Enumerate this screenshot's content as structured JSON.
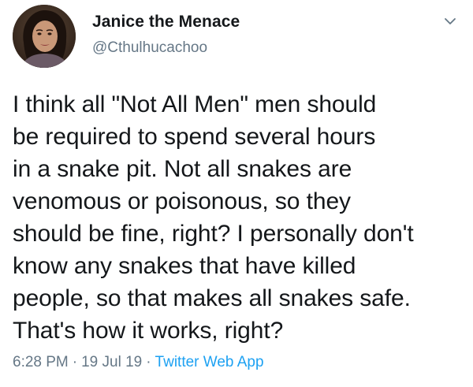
{
  "tweet": {
    "author": {
      "display_name": "Janice the Menace",
      "handle": "@Cthulhucachoo",
      "avatar_icon": "user-avatar-photo"
    },
    "menu_icon": "chevron-down-icon",
    "text": "I think all \"Not All Men\" men should\nbe required to spend several hours\nin a snake pit. Not all snakes are\nvenomous or poisonous, so they\nshould be fine, right? I personally don't\nknow any snakes that have killed\npeople, so that makes all snakes safe.\nThat's how it works, right?",
    "meta": {
      "time": "6:28 PM",
      "separator": "·",
      "date": "19 Jul 19",
      "source": "Twitter Web App"
    },
    "colors": {
      "text": "#14171a",
      "secondary": "#657786",
      "link": "#1da1f2"
    }
  }
}
